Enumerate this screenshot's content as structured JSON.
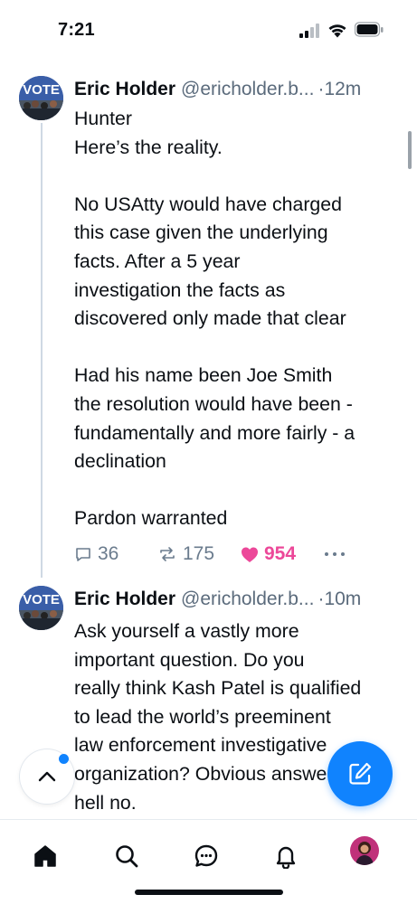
{
  "status_bar": {
    "time": "7:21"
  },
  "posts": [
    {
      "author": "Eric Holder",
      "handle": "@ericholder.b...",
      "separator": "·",
      "time": "12m",
      "avatar_text": "VOTE",
      "text_lines": [
        "Hunter",
        "Here’s the reality.",
        "",
        "No USAtty would have charged",
        "this case given the underlying",
        "facts.  After a 5 year",
        "investigation the facts as",
        "discovered only made that clear",
        "",
        "Had his name been Joe Smith",
        "the resolution would have been -",
        "fundamentally and more fairly - a",
        "declination",
        "",
        "Pardon warranted"
      ],
      "replies": "36",
      "reposts": "175",
      "likes": "954",
      "liked": true
    },
    {
      "author": "Eric Holder",
      "handle": "@ericholder.b...",
      "separator": "·",
      "time": "10m",
      "avatar_text": "VOTE",
      "text_lines": [
        "Ask yourself a vastly more",
        "important question.  Do you",
        "really think Kash Patel is qualified",
        "to lead the world’s preeminent",
        "law enforcement investigative",
        "organization?  Obvious answer -",
        "hell no."
      ]
    }
  ],
  "bottom_nav": {
    "items": [
      "home-icon",
      "search-icon",
      "chat-icon",
      "bell-icon",
      "profile-avatar"
    ]
  },
  "colors": {
    "accent": "#1083fe",
    "like": "#ec4899",
    "muted": "#6a7b8d"
  }
}
